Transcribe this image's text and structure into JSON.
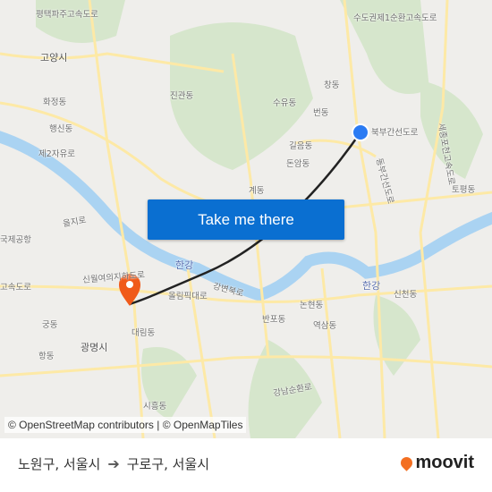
{
  "map": {
    "labels": [
      "평택파주고속도로",
      "수도권제1순환고속도로",
      "고양시",
      "창동",
      "진관동",
      "수유동",
      "번동",
      "화정동",
      "행신동",
      "제2자유로",
      "길음동",
      "돈암동",
      "북부간선도로",
      "동부간선도로",
      "세종포천고속도로",
      "계동",
      "을지로",
      "토평동",
      "국제공항",
      "한강",
      "한강",
      "신월여의지하도로",
      "올림픽대로",
      "강변북로",
      "논현동",
      "반포동",
      "역삼동",
      "신천동",
      "궁동",
      "대림동",
      "광명시",
      "항동",
      "강남순환로",
      "시흥동",
      "고속도로"
    ],
    "colors": {
      "land": "#efeeeb",
      "park": "#cfe3c4",
      "water": "#aad3f2",
      "road": "#fde9a6",
      "route": "#222222",
      "origin": "#2b7bf3",
      "destination": "#f05a1a"
    },
    "origin_marker_icon": "origin-dot-icon",
    "destination_marker_icon": "map-pin-icon"
  },
  "cta": {
    "label": "Take me there"
  },
  "attribution": "© OpenStreetMap contributors | © OpenMapTiles",
  "footer": {
    "origin": "노원구, 서울시",
    "arrow_icon": "arrow-right-icon",
    "destination": "구로구, 서울시",
    "brand": "moovit",
    "brand_color": "#f36f21"
  }
}
